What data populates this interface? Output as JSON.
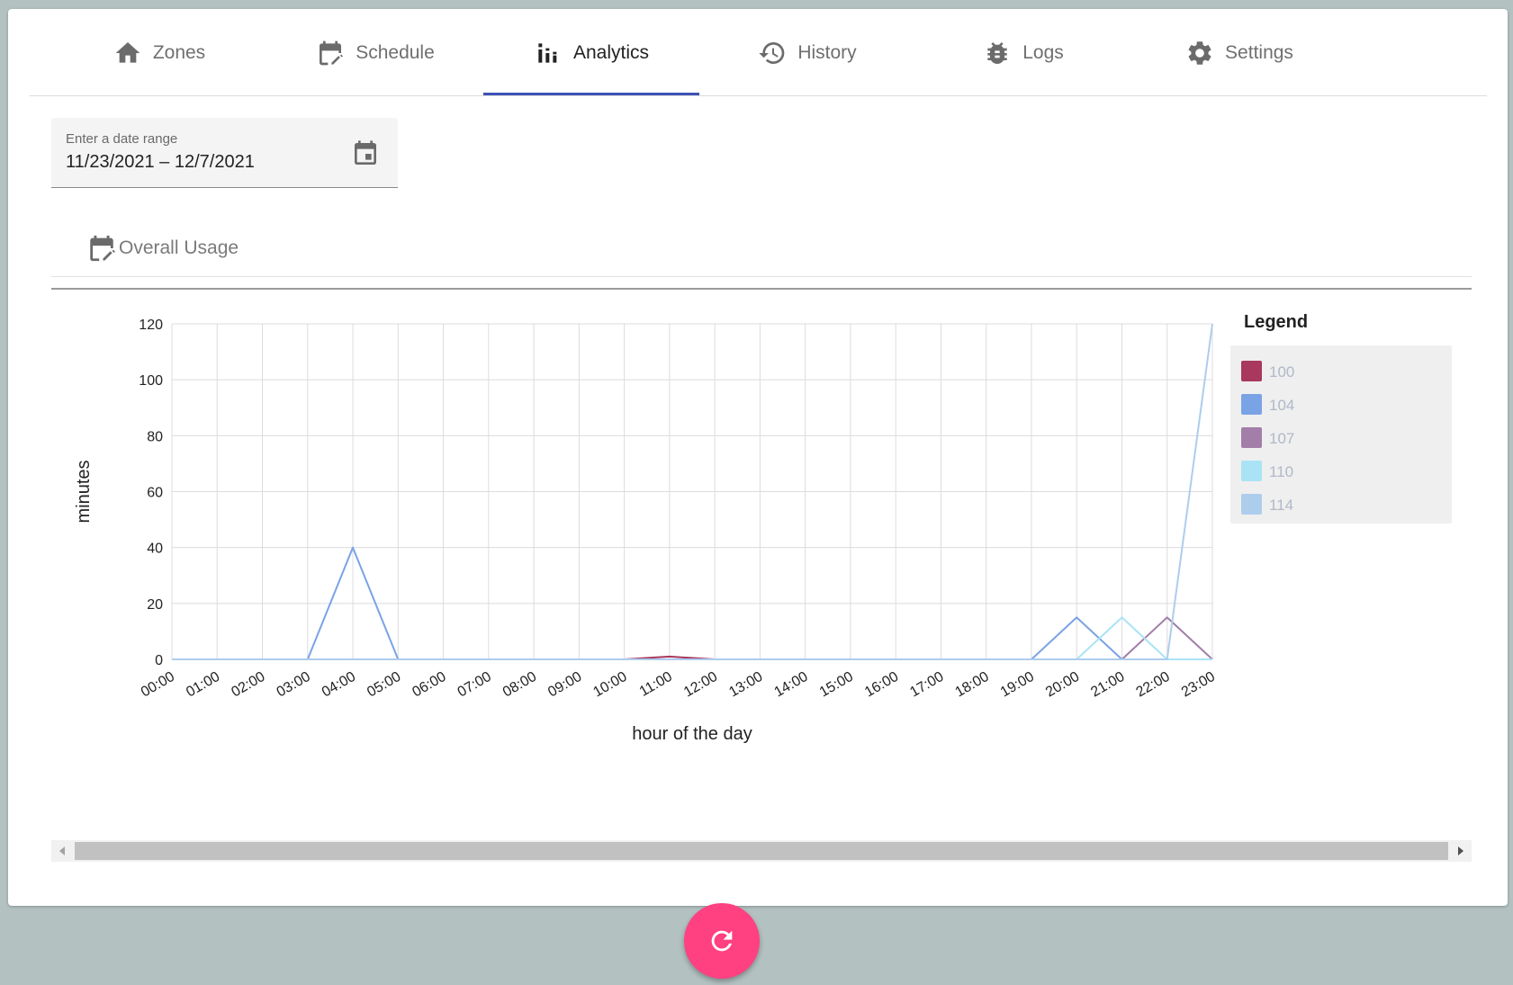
{
  "tabs": [
    {
      "label": "Zones",
      "icon": "home-icon"
    },
    {
      "label": "Schedule",
      "icon": "calendar-edit-icon"
    },
    {
      "label": "Analytics",
      "icon": "analytics-icon"
    },
    {
      "label": "History",
      "icon": "history-icon"
    },
    {
      "label": "Logs",
      "icon": "bug-icon"
    },
    {
      "label": "Settings",
      "icon": "gear-icon"
    }
  ],
  "active_tab": "Analytics",
  "date_range": {
    "label": "Enter a date range",
    "value": "11/23/2021 – 12/7/2021",
    "icon": "calendar-icon"
  },
  "subtab": {
    "label": "Overall Usage",
    "icon": "calendar-edit-icon"
  },
  "fab": {
    "icon": "refresh-icon",
    "color": "#ff4081"
  },
  "accent_color": "#3f51b5",
  "chart_data": {
    "type": "line",
    "title": "",
    "xlabel": "hour of the day",
    "ylabel": "minutes",
    "ylim": [
      0,
      120
    ],
    "yticks": [
      0,
      20,
      40,
      60,
      80,
      100,
      120
    ],
    "grid": true,
    "legend_title": "Legend",
    "legend_position": "right",
    "categories": [
      "00:00",
      "01:00",
      "02:00",
      "03:00",
      "04:00",
      "05:00",
      "06:00",
      "07:00",
      "08:00",
      "09:00",
      "10:00",
      "11:00",
      "12:00",
      "13:00",
      "14:00",
      "15:00",
      "16:00",
      "17:00",
      "18:00",
      "19:00",
      "20:00",
      "21:00",
      "22:00",
      "23:00"
    ],
    "series": [
      {
        "name": "100",
        "color": "#a8385d",
        "values": [
          0,
          0,
          0,
          0,
          0,
          0,
          0,
          0,
          0,
          0,
          0,
          1,
          0,
          0,
          0,
          0,
          0,
          0,
          0,
          0,
          0,
          0,
          0,
          0
        ]
      },
      {
        "name": "104",
        "color": "#7aa3e5",
        "values": [
          0,
          0,
          0,
          0,
          40,
          0,
          0,
          0,
          0,
          0,
          0,
          0,
          0,
          0,
          0,
          0,
          0,
          0,
          0,
          0,
          15,
          0,
          0,
          0
        ]
      },
      {
        "name": "107",
        "color": "#a27ea8",
        "values": [
          0,
          0,
          0,
          0,
          0,
          0,
          0,
          0,
          0,
          0,
          0,
          0,
          0,
          0,
          0,
          0,
          0,
          0,
          0,
          0,
          0,
          0,
          15,
          0
        ]
      },
      {
        "name": "110",
        "color": "#aae3f5",
        "values": [
          0,
          0,
          0,
          0,
          0,
          0,
          0,
          0,
          0,
          0,
          0,
          0,
          0,
          0,
          0,
          0,
          0,
          0,
          0,
          0,
          0,
          15,
          0,
          0
        ]
      },
      {
        "name": "114",
        "color": "#adcded",
        "values": [
          0,
          0,
          0,
          0,
          0,
          0,
          0,
          0,
          0,
          0,
          0,
          0,
          0,
          0,
          0,
          0,
          0,
          0,
          0,
          0,
          0,
          0,
          0,
          120
        ]
      }
    ]
  }
}
